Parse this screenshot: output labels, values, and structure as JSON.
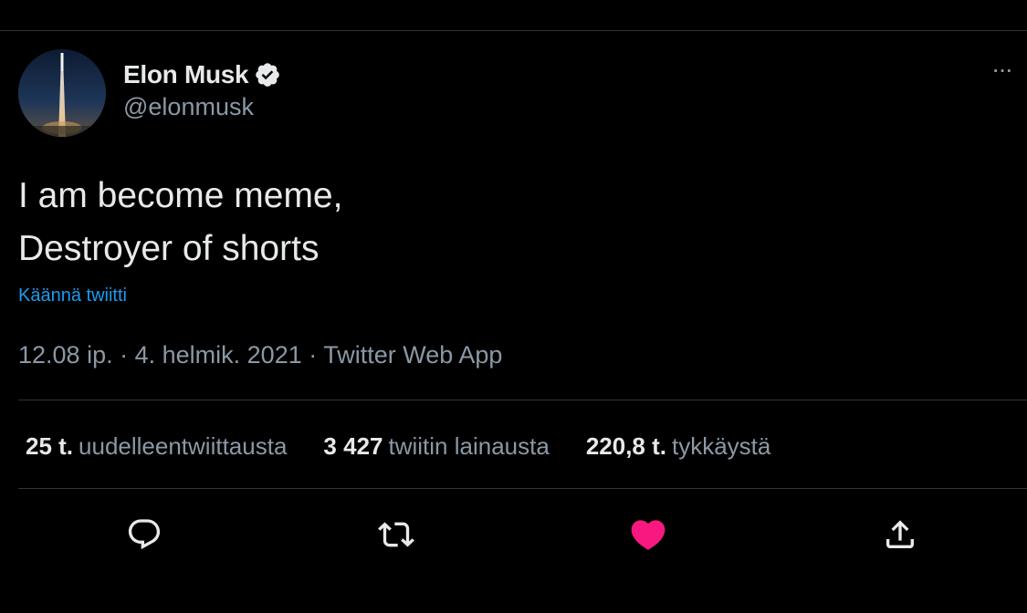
{
  "author": {
    "display_name": "Elon Musk",
    "handle": "@elonmusk",
    "verified": true
  },
  "tweet": {
    "lines": [
      "I am become meme,",
      "Destroyer of shorts"
    ],
    "translate_label": "Käännä twiitti"
  },
  "meta": {
    "time": "12.08 ip.",
    "separator": "·",
    "date": "4. helmik. 2021",
    "source": "Twitter Web App"
  },
  "stats": {
    "retweets_count": "25 t.",
    "retweets_label": "uudelleentwiittausta",
    "quotes_count": "3 427",
    "quotes_label": "twiitin lainausta",
    "likes_count": "220,8 t.",
    "likes_label": "tykkäystä"
  },
  "actions": {
    "more": "···",
    "reply_icon": "reply-icon",
    "retweet_icon": "retweet-icon",
    "like_icon": "heart-icon",
    "share_icon": "share-icon",
    "liked": true
  },
  "colors": {
    "background": "#000000",
    "text_primary": "#e7e9ea",
    "text_secondary": "#8b98a5",
    "link": "#1d9bf0",
    "like": "#f91880",
    "divider": "#2f3336"
  }
}
